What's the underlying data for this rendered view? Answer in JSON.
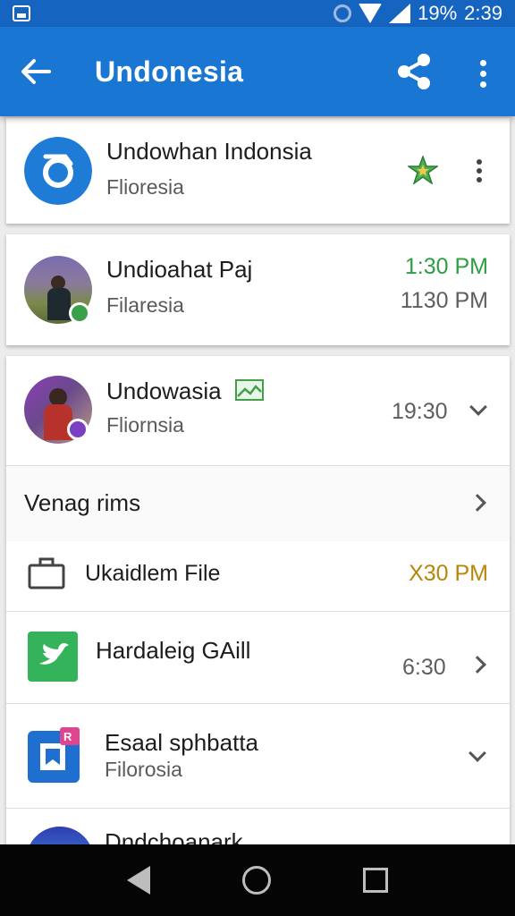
{
  "status_bar": {
    "battery": "19%",
    "time": "2:39"
  },
  "app_bar": {
    "title": "Undonesia",
    "back_icon": "arrow-back-icon",
    "share_icon": "share-icon",
    "menu_icon": "more-vert-icon"
  },
  "colors": {
    "status_bar": "#1565c0",
    "app_bar": "#1976d2",
    "green_time": "#2e9e43",
    "gold_time": "#b8860b"
  },
  "items": [
    {
      "title": "Undowhan Indonsia",
      "subtitle": "Flioresia",
      "icon": "compass-icon",
      "trailing_icon": "star-icon",
      "menu_icon": "more-vert-icon"
    },
    {
      "title": "Undioahat Paj",
      "subtitle": "Filaresia",
      "time_top": "1:30 PM",
      "time_bottom": "1130 PM",
      "icon": "person-photo-avatar"
    },
    {
      "title": "Undowasia",
      "subtitle": "Fliornsia",
      "time": "19:30",
      "icon": "person-photo-avatar",
      "title_icon": "image-icon",
      "trailing_icon": "chevron-down-icon"
    }
  ],
  "section": {
    "label": "Venag rims",
    "trailing_icon": "chevron-right-icon"
  },
  "file_row": {
    "label": "Ukaidlem File",
    "time": "X30 PM",
    "icon": "briefcase-icon"
  },
  "app_rows": [
    {
      "title": "Hardaleig GAill",
      "time": "6:30",
      "icon": "twitter-bird-icon",
      "trailing_icon": "chevron-right-icon"
    },
    {
      "title": "Esaal sphbatta",
      "subtitle": "Filorosia",
      "icon": "bookmark-app-icon",
      "trailing_icon": "chevron-down-icon"
    },
    {
      "title": "Dndchoanark",
      "icon": "person-photo-avatar"
    }
  ],
  "nav": {
    "back": "nav-back-icon",
    "home": "nav-home-icon",
    "recent": "nav-recents-icon"
  }
}
